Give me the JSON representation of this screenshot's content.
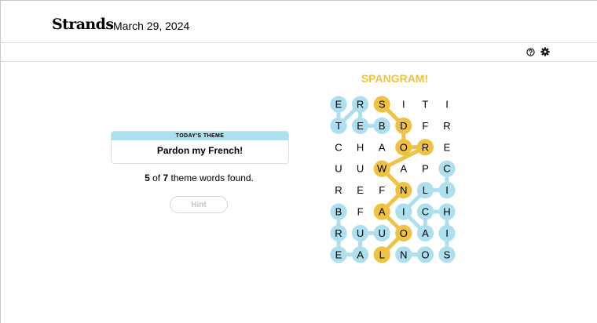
{
  "header": {
    "logo": "Strands",
    "date": "March 29, 2024"
  },
  "toolbar": {
    "help_icon": "help-circle-icon",
    "settings_icon": "gear-icon"
  },
  "theme": {
    "heading": "TODAY'S THEME",
    "title": "Pardon my French!"
  },
  "progress": {
    "found": "5",
    "of_text": " of ",
    "total": "7",
    "suffix": " theme words found."
  },
  "hint": {
    "label": "Hint"
  },
  "status": {
    "banner": "SPANGRAM!"
  },
  "colors": {
    "theme_word": "#aedfee",
    "spangram": "#f0c243"
  },
  "grid": {
    "rows": [
      [
        "E",
        "R",
        "S",
        "I",
        "T",
        "I"
      ],
      [
        "T",
        "E",
        "B",
        "D",
        "F",
        "R"
      ],
      [
        "C",
        "H",
        "A",
        "O",
        "R",
        "E"
      ],
      [
        "U",
        "U",
        "W",
        "A",
        "P",
        "C"
      ],
      [
        "R",
        "E",
        "F",
        "N",
        "L",
        "I"
      ],
      [
        "B",
        "F",
        "A",
        "I",
        "C",
        "H"
      ],
      [
        "R",
        "U",
        "U",
        "O",
        "A",
        "I"
      ],
      [
        "E",
        "A",
        "L",
        "N",
        "O",
        "S"
      ]
    ],
    "states": [
      [
        "theme",
        "theme",
        "spangram",
        "none",
        "none",
        "none"
      ],
      [
        "theme",
        "theme",
        "theme",
        "spangram",
        "none",
        "none"
      ],
      [
        "none",
        "none",
        "none",
        "spangram",
        "spangram",
        "none"
      ],
      [
        "none",
        "none",
        "spangram",
        "none",
        "none",
        "theme"
      ],
      [
        "none",
        "none",
        "none",
        "spangram",
        "theme",
        "theme"
      ],
      [
        "theme",
        "none",
        "spangram",
        "theme",
        "theme",
        "theme"
      ],
      [
        "theme",
        "theme",
        "theme",
        "spangram",
        "theme",
        "theme"
      ],
      [
        "theme",
        "theme",
        "spangram",
        "theme",
        "theme",
        "theme"
      ]
    ],
    "paths": [
      {
        "state": "theme",
        "cells": [
          [
            0,
            0
          ],
          [
            1,
            0
          ],
          [
            0,
            1
          ],
          [
            1,
            1
          ],
          [
            1,
            2
          ]
        ]
      },
      {
        "state": "spangram",
        "cells": [
          [
            0,
            2
          ],
          [
            1,
            3
          ],
          [
            2,
            3
          ],
          [
            2,
            4
          ],
          [
            3,
            2
          ],
          [
            4,
            3
          ],
          [
            5,
            2
          ],
          [
            6,
            3
          ],
          [
            7,
            2
          ]
        ]
      },
      {
        "state": "theme",
        "cells": [
          [
            5,
            0
          ],
          [
            6,
            0
          ],
          [
            7,
            0
          ],
          [
            7,
            1
          ],
          [
            6,
            1
          ],
          [
            6,
            2
          ]
        ]
      },
      {
        "state": "theme",
        "cells": [
          [
            3,
            5
          ],
          [
            4,
            5
          ],
          [
            4,
            4
          ],
          [
            5,
            3
          ],
          [
            6,
            4
          ],
          [
            5,
            4
          ],
          [
            5,
            5
          ],
          [
            6,
            5
          ],
          [
            7,
            5
          ]
        ]
      },
      {
        "state": "theme",
        "cells": [
          [
            7,
            3
          ],
          [
            7,
            4
          ]
        ]
      }
    ]
  }
}
